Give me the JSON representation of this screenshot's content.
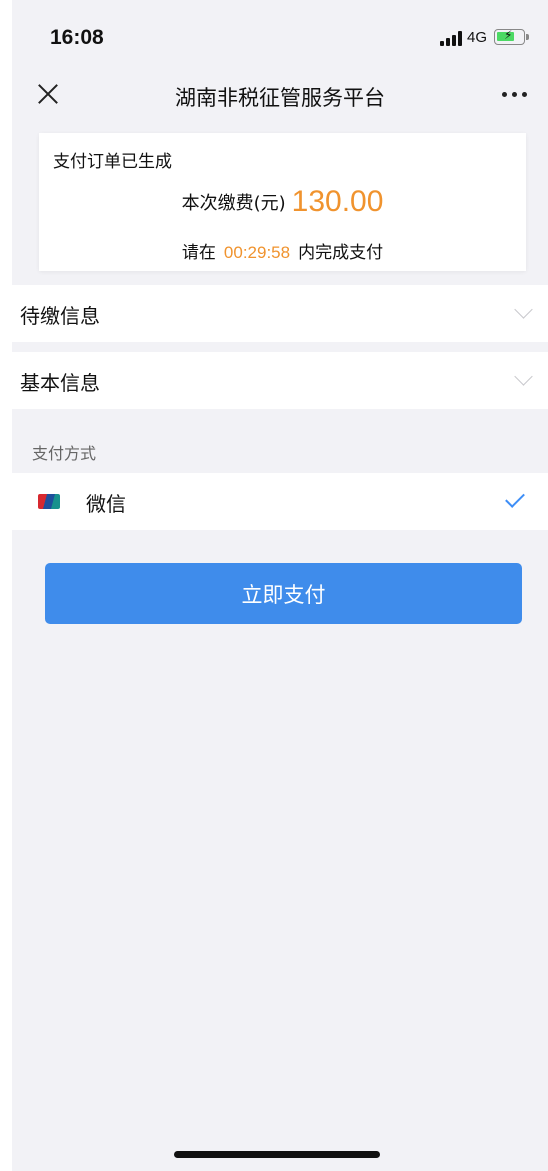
{
  "status_bar": {
    "time": "16:08",
    "network": "4G"
  },
  "nav": {
    "title": "湖南非税征管服务平台"
  },
  "order": {
    "status": "支付订单已生成",
    "fee_label": "本次缴费(元)",
    "fee_amount": "130.00",
    "deadline_prefix": "请在",
    "countdown": "00:29:58",
    "deadline_suffix": "内完成支付"
  },
  "sections": {
    "pending_info": "待缴信息",
    "basic_info": "基本信息"
  },
  "payment": {
    "section_title": "支付方式",
    "method_label": "微信",
    "method_selected": true
  },
  "actions": {
    "pay_button": "立即支付"
  },
  "colors": {
    "accent": "#3f8ceb",
    "amount": "#f0932e",
    "check": "#3e8ef7",
    "background": "#f2f2f6"
  }
}
